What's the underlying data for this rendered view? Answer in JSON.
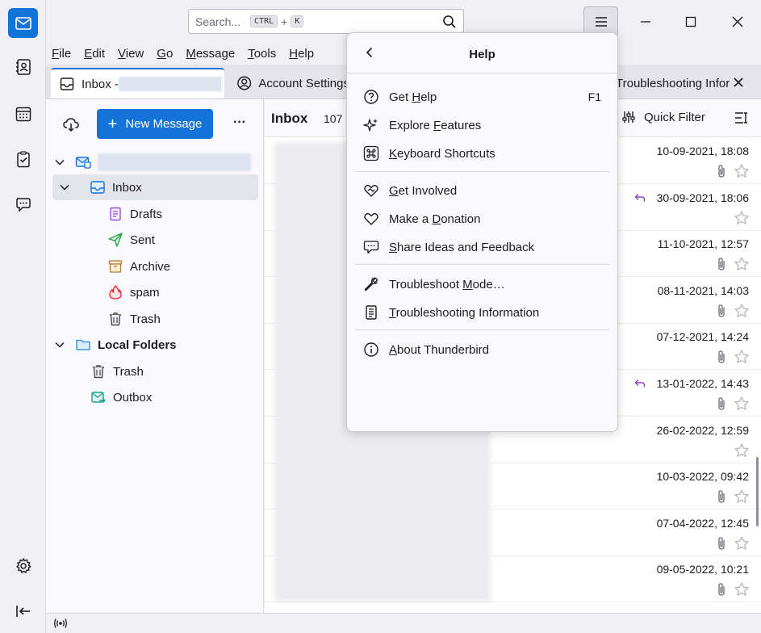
{
  "search": {
    "placeholder": "Search...",
    "key1": "CTRL",
    "plus": "+",
    "key2": "K"
  },
  "menubar": [
    {
      "label": "File",
      "u": "F",
      "rest": "ile"
    },
    {
      "label": "Edit",
      "u": "E",
      "rest": "dit"
    },
    {
      "label": "View",
      "u": "V",
      "rest": "iew"
    },
    {
      "label": "Go",
      "u": "G",
      "rest": "o"
    },
    {
      "label": "Message",
      "u": "M",
      "rest": "essage"
    },
    {
      "label": "Tools",
      "u": "T",
      "rest": "ools"
    },
    {
      "label": "Help",
      "u": "H",
      "rest": "elp"
    }
  ],
  "tabs": {
    "inbox": "Inbox - ",
    "account_settings": "Account Settings",
    "troubleshooting": "Troubleshooting Infor"
  },
  "folderpane": {
    "new_message": "New Message",
    "more": "···",
    "folders": {
      "inbox": "Inbox",
      "drafts": "Drafts",
      "sent": "Sent",
      "archive": "Archive",
      "spam": "spam",
      "trash": "Trash",
      "local_folders": "Local Folders",
      "local_trash": "Trash",
      "outbox": "Outbox"
    }
  },
  "messagelist": {
    "title": "Inbox",
    "count": "107",
    "quick_filter": "Quick Filter",
    "rows": [
      {
        "date": "10-09-2021, 18:08",
        "attach": true,
        "reply": false
      },
      {
        "date": "30-09-2021, 18:06",
        "attach": false,
        "reply": true
      },
      {
        "date": "11-10-2021, 12:57",
        "attach": true,
        "reply": false
      },
      {
        "date": "08-11-2021, 14:03",
        "attach": true,
        "reply": false
      },
      {
        "date": "07-12-2021, 14:24",
        "attach": true,
        "reply": false
      },
      {
        "date": "13-01-2022, 14:43",
        "attach": true,
        "reply": true
      },
      {
        "date": "26-02-2022, 12:59",
        "attach": false,
        "reply": false
      },
      {
        "date": "10-03-2022, 09:42",
        "attach": true,
        "reply": false
      },
      {
        "date": "07-04-2022, 12:45",
        "attach": true,
        "reply": false
      },
      {
        "date": "09-05-2022, 10:21",
        "attach": true,
        "reply": false
      }
    ]
  },
  "help_panel": {
    "title": "Help",
    "items": [
      {
        "pre": "Get ",
        "u": "H",
        "post": "elp",
        "shortcut": "F1"
      },
      {
        "pre": "Explore ",
        "u": "F",
        "post": "eatures"
      },
      {
        "pre": "",
        "u": "K",
        "post": "eyboard Shortcuts"
      },
      {
        "pre": "",
        "u": "G",
        "post": "et Involved"
      },
      {
        "pre": "Make a ",
        "u": "D",
        "post": "onation"
      },
      {
        "pre": "",
        "u": "S",
        "post": "hare Ideas and Feedback"
      },
      {
        "pre": "Troubleshoot ",
        "u": "M",
        "post": "ode…"
      },
      {
        "pre": "",
        "u": "T",
        "post": "roubleshooting Information"
      },
      {
        "pre": "",
        "u": "A",
        "post": "bout Thunderbird"
      }
    ]
  },
  "colors": {
    "accent": "#1373d9",
    "reply": "#8f45c4"
  }
}
